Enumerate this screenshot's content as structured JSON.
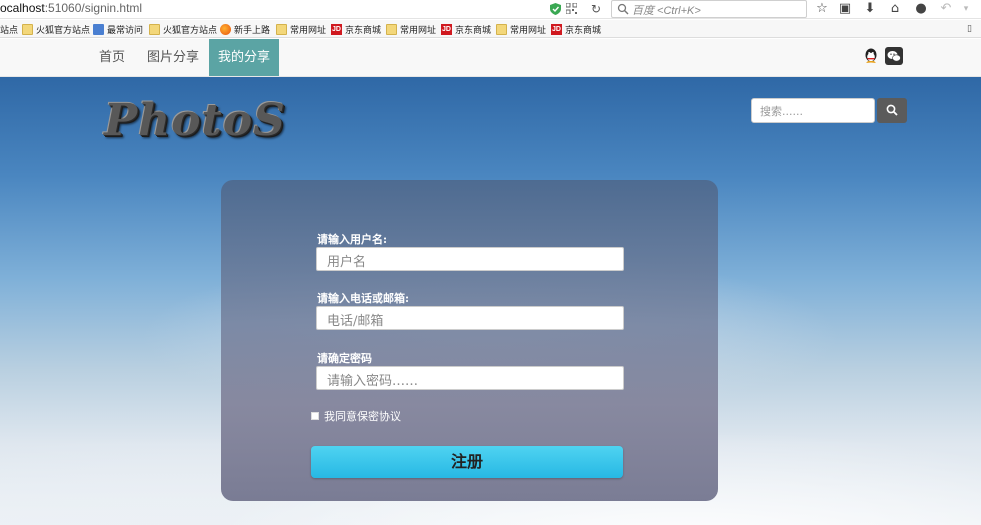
{
  "browser": {
    "url_host": "ocalhost",
    "url_rest": ":51060/signin.html",
    "search_placeholder": "百度 <Ctrl+K>"
  },
  "bookmarks": [
    {
      "label": "站点",
      "icon": "none"
    },
    {
      "label": "火狐官方站点",
      "icon": "folder-icon"
    },
    {
      "label": "最常访问",
      "icon": "page-icon"
    },
    {
      "label": "火狐官方站点",
      "icon": "folder-icon"
    },
    {
      "label": "新手上路",
      "icon": "firefox-icon"
    },
    {
      "label": "常用网址",
      "icon": "folder-icon"
    },
    {
      "label": "京东商城",
      "icon": "jd-icon"
    },
    {
      "label": "常用网址",
      "icon": "folder-icon"
    },
    {
      "label": "京东商城",
      "icon": "jd-icon"
    },
    {
      "label": "常用网址",
      "icon": "folder-icon"
    },
    {
      "label": "京东商城",
      "icon": "jd-icon"
    }
  ],
  "nav": {
    "items": [
      "首页",
      "图片分享",
      "我的分享"
    ],
    "active": "我的分享"
  },
  "hero": {
    "logo": "PhotoS",
    "search_placeholder": "搜索......"
  },
  "form": {
    "username_label": "请输入用户名:",
    "username_placeholder": "用户名",
    "contact_label": "请输入电话或邮箱:",
    "contact_placeholder": "电话/邮箱",
    "password_label": "请确定密码",
    "password_placeholder": "请输入密码……",
    "agree_label": "我同意保密协议",
    "submit_label": "注册"
  },
  "colors": {
    "nav_active": "#5ba4a4",
    "submit": "#2ec0ea"
  }
}
